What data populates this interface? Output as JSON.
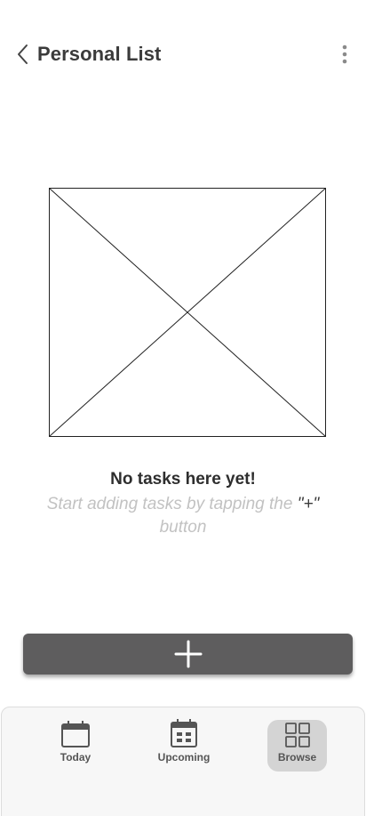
{
  "header": {
    "title": "Personal List",
    "back_icon": "chevron-left-icon",
    "more_icon": "more-vertical-icon"
  },
  "empty_state": {
    "title": "No tasks here yet!",
    "subtitle_before": "Start adding tasks by tapping the ",
    "subtitle_highlight": "\"+\"",
    "subtitle_after": " button"
  },
  "add_button": {
    "icon": "plus-icon",
    "color": "#5e5d5e"
  },
  "bottom_nav": {
    "items": [
      {
        "label": "Today",
        "icon": "calendar-icon",
        "active": false
      },
      {
        "label": "Upcoming",
        "icon": "calendar-grid-icon",
        "active": false
      },
      {
        "label": "Browse",
        "icon": "grid-icon",
        "active": true
      }
    ]
  }
}
